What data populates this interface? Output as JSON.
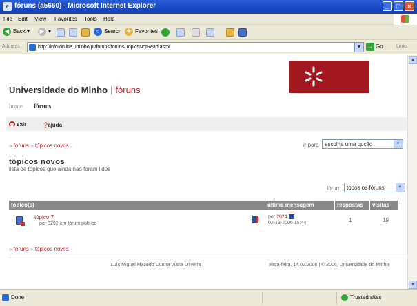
{
  "window": {
    "title": "fóruns (a5660) - Microsoft Internet Explorer",
    "minimize": "_",
    "maximize": "□",
    "close": "×"
  },
  "menu": [
    "File",
    "Edit",
    "View",
    "Favorites",
    "Tools",
    "Help"
  ],
  "toolbar": {
    "back": "Back",
    "search": "Search",
    "favorites": "Favorites"
  },
  "address": {
    "label": "Address",
    "url": "http://info-online.uminho.pt/foruns/foruns/TopicsNotRead.aspx",
    "go": "Go",
    "links": "Links"
  },
  "site": {
    "name": "Universidade do Minho",
    "separator": "|",
    "section": "fóruns"
  },
  "nav": {
    "home": "home",
    "current": "fóruns"
  },
  "actions": {
    "sair": "sair",
    "ajuda": "ajuda"
  },
  "breadcrumb": {
    "root": "fóruns",
    "current": "tópicos novos"
  },
  "goto": {
    "label": "ir para",
    "selected": "escolha uma opção"
  },
  "heading": {
    "title": "tópicos novos",
    "subtitle": "lista de tópicos que ainda não foram lidos"
  },
  "forum_filter": {
    "label": "fórum",
    "selected": "todos os fóruns"
  },
  "table": {
    "headers": [
      "tópico(s)",
      "última mensagem",
      "respostas",
      "visitas"
    ],
    "rows": [
      {
        "title": "tópico 7",
        "meta": "por 3292 em fórum público",
        "last_by_prefix": "por",
        "last_by": "2024",
        "last_date": "02-13-2006 15:44",
        "replies": "1",
        "visits": "19"
      }
    ]
  },
  "footer": {
    "author": "Luís Miguel Macedo Cunha Viana Oliveira",
    "date": "terça-feira, 14.02.2006 | © 2006, Universidade do Minho"
  },
  "status": {
    "left": "Done",
    "right": "Trusted sites"
  },
  "colors": {
    "accent": "#b22a2a",
    "logo_bg": "#a3171f",
    "header_bg": "#8a8a8a"
  }
}
